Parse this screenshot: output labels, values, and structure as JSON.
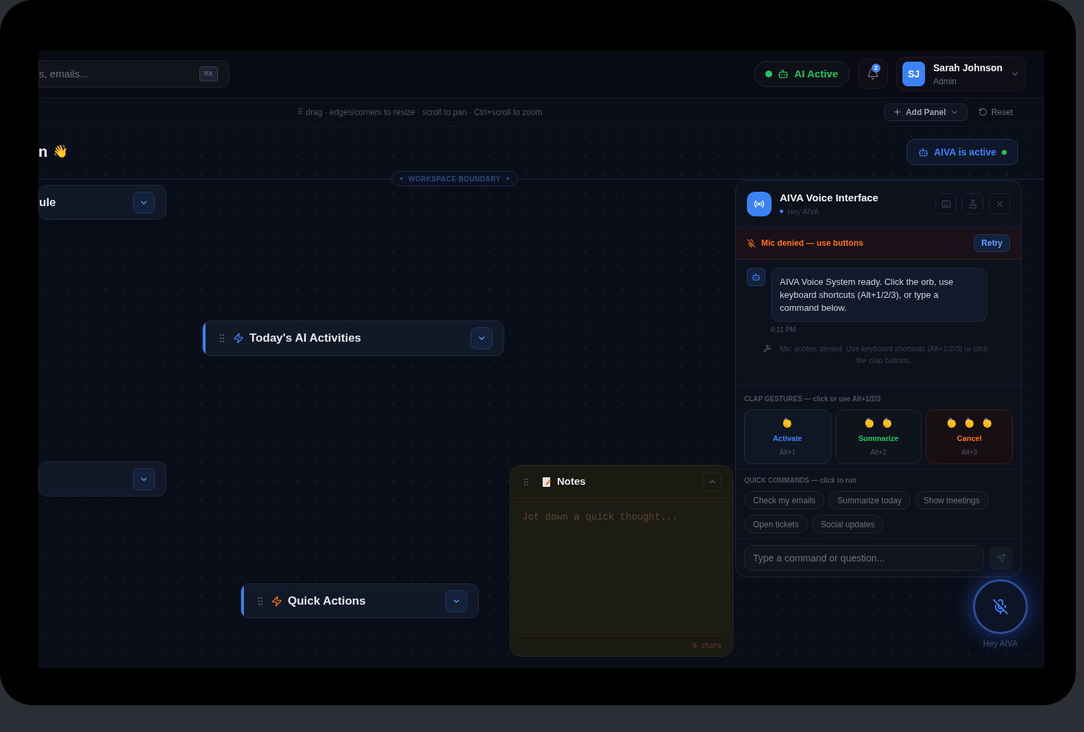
{
  "search": {
    "placeholder": "s, emails...",
    "shortcut": "⌘K"
  },
  "ai_status": {
    "label": "AI Active",
    "on": true
  },
  "notifications": {
    "count": "2"
  },
  "user": {
    "initials": "SJ",
    "name": "Sarah Johnson",
    "role": "Admin"
  },
  "toolbar": {
    "hint": "⠿ drag · edges/corners to resize · scroll to pan · Ctrl+scroll to zoom",
    "add_panel": "Add Panel",
    "reset": "Reset"
  },
  "greeting": {
    "text": "n",
    "emoji": "👋"
  },
  "aiva_status": {
    "label": "AIVA is active",
    "on": true
  },
  "boundary": {
    "label": "WORKSPACE BOUNDARY"
  },
  "panels": [
    {
      "title": "ule",
      "expanded": false
    },
    {
      "title": "Today's AI Activities",
      "color": "#3b82f6",
      "expanded": false
    },
    {
      "expanded": false
    },
    {
      "title": "Quick Actions",
      "color": "#f97316",
      "expanded": false
    }
  ],
  "notes": {
    "title": "Notes",
    "placeholder": "Jot down a quick thought...",
    "char_count": "0 chars",
    "expanded": true
  },
  "voice": {
    "title": "AIVA Voice Interface",
    "wake_word": "Hey AIVA",
    "alert": {
      "text": "Mic denied — use buttons",
      "action": "Retry"
    },
    "messages": [
      {
        "text": "AIVA Voice System ready. Click the orb, use keyboard shortcuts (Alt+1/2/3), or type a command below.",
        "time": "6:11 PM"
      }
    ],
    "system_note": "Mic access denied. Use keyboard shortcuts (Alt+1/2/3) or click the clap buttons.",
    "clap_heading": "CLAP GESTURES — click or use Alt+1/2/3",
    "gestures": [
      {
        "label": "Activate",
        "shortcut": "Alt+1",
        "color": "#3b82f6"
      },
      {
        "label": "Summarize",
        "shortcut": "Alt+2",
        "color": "#22c55e"
      },
      {
        "label": "Cancel",
        "shortcut": "Alt+3",
        "color": "#f97316"
      }
    ],
    "quick_heading": "QUICK COMMANDS — click to run",
    "commands": [
      "Check my emails",
      "Summarize today",
      "Show meetings",
      "Open tickets",
      "Social updates"
    ],
    "input_placeholder": "Type a command or question..."
  },
  "orb": {
    "label": "Hey AIVA"
  }
}
